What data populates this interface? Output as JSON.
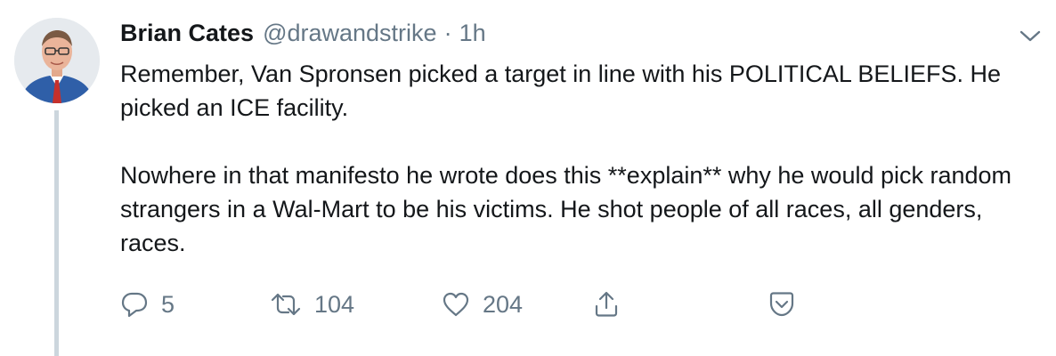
{
  "tweet": {
    "display_name": "Brian Cates",
    "handle": "@drawandstrike",
    "separator": "·",
    "time": "1h",
    "paragraphs": [
      "Remember, Van Spronsen picked a target in line with his POLITICAL BELIEFS.  He picked an ICE facility.",
      "Nowhere in that manifesto he wrote does this **explain** why he would pick random strangers in a Wal-Mart to be his victims. He shot people of all races, all genders, races."
    ]
  },
  "actions": {
    "replies": "5",
    "retweets": "104",
    "likes": "204"
  },
  "icons": {
    "caret": "chevron-down-icon",
    "reply": "reply-icon",
    "retweet": "retweet-icon",
    "like": "heart-icon",
    "share": "share-icon",
    "save": "bookmark-icon"
  },
  "colors": {
    "text": "#14171a",
    "secondary": "#657786",
    "thread_line": "#ccd6dd"
  }
}
